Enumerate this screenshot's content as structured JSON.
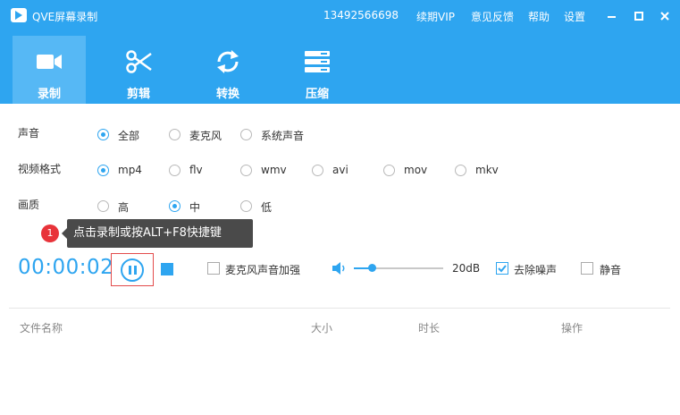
{
  "window": {
    "title": "QVE屏幕录制",
    "phone": "13492566698",
    "menu": [
      "续期VIP",
      "意见反馈",
      "帮助",
      "设置"
    ],
    "controls": [
      "minimize-icon",
      "maximize-icon",
      "close-icon"
    ]
  },
  "tabs": [
    {
      "label": "录制",
      "icon": "video-camera-icon",
      "active": true
    },
    {
      "label": "剪辑",
      "icon": "scissors-icon",
      "active": false
    },
    {
      "label": "转换",
      "icon": "refresh-icon",
      "active": false
    },
    {
      "label": "压缩",
      "icon": "compress-icon",
      "active": false
    }
  ],
  "options": {
    "audio": {
      "label": "声音",
      "choices": [
        "全部",
        "麦克风",
        "系统声音"
      ],
      "selected": "全部"
    },
    "format": {
      "label": "视频格式",
      "choices": [
        "mp4",
        "flv",
        "wmv",
        "avi",
        "mov",
        "mkv"
      ],
      "selected": "mp4"
    },
    "quality": {
      "label": "画质",
      "choices": [
        "高",
        "中",
        "低"
      ],
      "selected": "中"
    }
  },
  "tip": {
    "badge": "1",
    "text": "点击录制或按ALT+F8快捷键"
  },
  "recording": {
    "timer": "00:00:02",
    "mic_boost_label": "麦克风声音加强",
    "mic_boost_checked": false,
    "volume_label": "20dB",
    "volume_level_fraction": 0.2,
    "denoise_label": "去除噪声",
    "denoise_checked": true,
    "mute_label": "静音",
    "mute_checked": false
  },
  "file_table": {
    "columns": [
      "文件名称",
      "大小",
      "时长",
      "操作"
    ],
    "rows": []
  },
  "colors": {
    "accent": "#2ea5f0",
    "active_tab": "#56b8f5",
    "tooltip_bg": "#4a4a4a",
    "badge": "#e8333a",
    "highlight_border": "#e34b4b"
  }
}
